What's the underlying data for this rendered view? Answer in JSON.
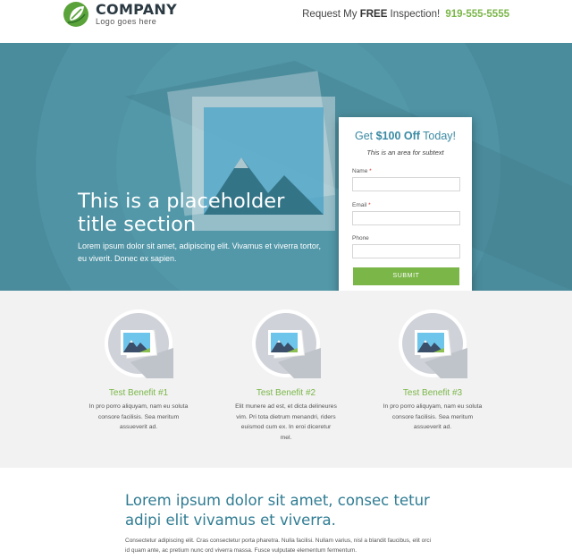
{
  "header": {
    "logo_name": "COMPANY",
    "logo_tagline": "Logo goes here",
    "cta_prefix": "Request My ",
    "cta_bold": "FREE",
    "cta_suffix": " Inspection! ",
    "phone": "919-555-5555"
  },
  "hero": {
    "title": "This is a placeholder title section",
    "subtitle": "Lorem ipsum dolor sit amet, adipiscing elit. Vivamus et viverra tortor, eu viverit. Donec ex sapien."
  },
  "form": {
    "heading_prefix": "Get ",
    "heading_bold": "$100 Off",
    "heading_suffix": " Today!",
    "subtext": "This is an area for subtext",
    "name_label": "Name",
    "email_label": "Email",
    "phone_label": "Phone",
    "required_mark": "*",
    "submit_label": "SUBMIT",
    "name_value": "",
    "email_value": "",
    "phone_value": ""
  },
  "benefits": [
    {
      "title": "Test Benefit #1",
      "description": "In pro porro aliquyam, nam eu soluta consore facilisis. Sea meritum assueverit ad."
    },
    {
      "title": "Test Benefit #2",
      "description": "Elit munere ad est, et dicta delineures vim. Pri tota dietrum menandri, riders euismod cum ex. In eroi diceretur mel."
    },
    {
      "title": "Test Benefit #3",
      "description": "In pro porro aliquyam, nam eu soluta consore facilisis. Sea meritum assueverit ad."
    }
  ],
  "content": {
    "title": "Lorem ipsum dolor sit amet, consec tetur adipi elit vivamus et viverra.",
    "body": "Consectetur adipiscing elit. Cras consectetur porta pharetra. Nulla facilisi. Nullam varius, nisl a blandit faucibus, elit orci id quam ante, ac pretium nunc ord viverra massa. Fusce vulputate elementum fermentum."
  },
  "colors": {
    "brand_green": "#7ab648",
    "hero_teal": "#4a8b9c",
    "heading_teal": "#2f7c93",
    "benefits_bg": "#f2f2f2"
  }
}
